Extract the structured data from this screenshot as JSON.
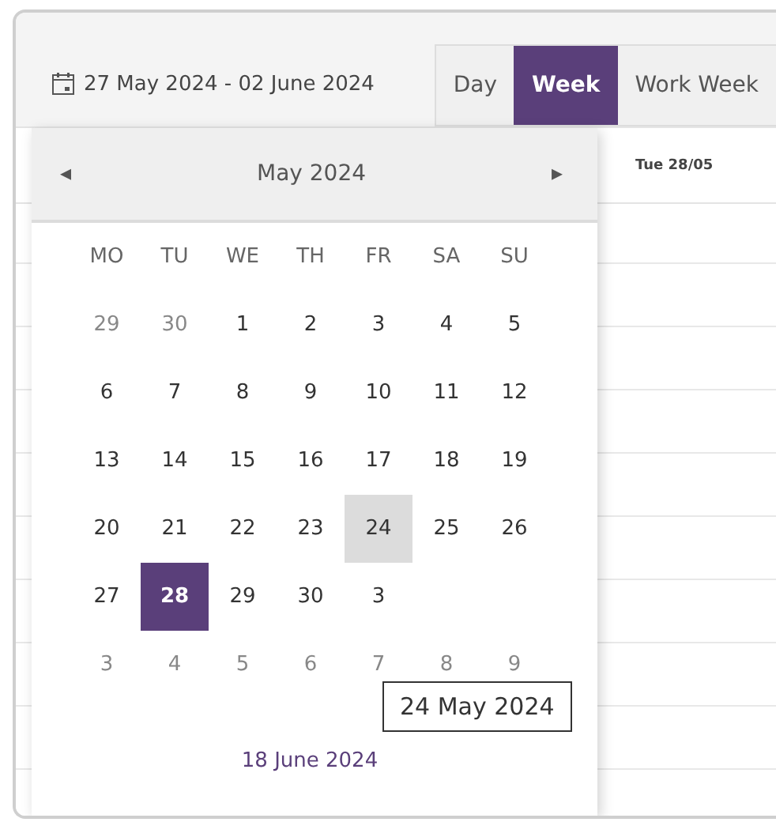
{
  "date_range": {
    "label": "27 May 2024 - 02 June 2024"
  },
  "view_tabs": [
    {
      "label": "Day",
      "selected": false
    },
    {
      "label": "Week",
      "selected": true
    },
    {
      "label": "Work Week",
      "selected": false
    }
  ],
  "week_header": {
    "label": "Tue 28/05"
  },
  "date_picker": {
    "prev": "◂",
    "title": "May 2024",
    "next": "▸",
    "weekdays": [
      "MO",
      "TU",
      "WE",
      "TH",
      "FR",
      "SA",
      "SU"
    ],
    "weeks": [
      [
        {
          "label": "29",
          "other_month": true,
          "selected": false,
          "hovered": false
        },
        {
          "label": "30",
          "other_month": true,
          "selected": false,
          "hovered": false
        },
        {
          "label": "1",
          "other_month": false,
          "selected": false,
          "hovered": false
        },
        {
          "label": "2",
          "other_month": false,
          "selected": false,
          "hovered": false
        },
        {
          "label": "3",
          "other_month": false,
          "selected": false,
          "hovered": false
        },
        {
          "label": "4",
          "other_month": false,
          "selected": false,
          "hovered": false
        },
        {
          "label": "5",
          "other_month": false,
          "selected": false,
          "hovered": false
        }
      ],
      [
        {
          "label": "6",
          "other_month": false,
          "selected": false,
          "hovered": false
        },
        {
          "label": "7",
          "other_month": false,
          "selected": false,
          "hovered": false
        },
        {
          "label": "8",
          "other_month": false,
          "selected": false,
          "hovered": false
        },
        {
          "label": "9",
          "other_month": false,
          "selected": false,
          "hovered": false
        },
        {
          "label": "10",
          "other_month": false,
          "selected": false,
          "hovered": false
        },
        {
          "label": "11",
          "other_month": false,
          "selected": false,
          "hovered": false
        },
        {
          "label": "12",
          "other_month": false,
          "selected": false,
          "hovered": false
        }
      ],
      [
        {
          "label": "13",
          "other_month": false,
          "selected": false,
          "hovered": false
        },
        {
          "label": "14",
          "other_month": false,
          "selected": false,
          "hovered": false
        },
        {
          "label": "15",
          "other_month": false,
          "selected": false,
          "hovered": false
        },
        {
          "label": "16",
          "other_month": false,
          "selected": false,
          "hovered": false
        },
        {
          "label": "17",
          "other_month": false,
          "selected": false,
          "hovered": false
        },
        {
          "label": "18",
          "other_month": false,
          "selected": false,
          "hovered": false
        },
        {
          "label": "19",
          "other_month": false,
          "selected": false,
          "hovered": false
        }
      ],
      [
        {
          "label": "20",
          "other_month": false,
          "selected": false,
          "hovered": false
        },
        {
          "label": "21",
          "other_month": false,
          "selected": false,
          "hovered": false
        },
        {
          "label": "22",
          "other_month": false,
          "selected": false,
          "hovered": false
        },
        {
          "label": "23",
          "other_month": false,
          "selected": false,
          "hovered": false
        },
        {
          "label": "24",
          "other_month": false,
          "selected": false,
          "hovered": true
        },
        {
          "label": "25",
          "other_month": false,
          "selected": false,
          "hovered": false
        },
        {
          "label": "26",
          "other_month": false,
          "selected": false,
          "hovered": false
        }
      ],
      [
        {
          "label": "27",
          "other_month": false,
          "selected": false,
          "hovered": false
        },
        {
          "label": "28",
          "other_month": false,
          "selected": true,
          "hovered": false
        },
        {
          "label": "29",
          "other_month": false,
          "selected": false,
          "hovered": false
        },
        {
          "label": "30",
          "other_month": false,
          "selected": false,
          "hovered": false
        },
        {
          "label": "3",
          "other_month": false,
          "selected": false,
          "hovered": false
        }
      ],
      [
        {
          "label": "3",
          "other_month": true,
          "selected": false,
          "hovered": false
        },
        {
          "label": "4",
          "other_month": true,
          "selected": false,
          "hovered": false
        },
        {
          "label": "5",
          "other_month": true,
          "selected": false,
          "hovered": false
        },
        {
          "label": "6",
          "other_month": true,
          "selected": false,
          "hovered": false
        },
        {
          "label": "7",
          "other_month": true,
          "selected": false,
          "hovered": false
        },
        {
          "label": "8",
          "other_month": true,
          "selected": false,
          "hovered": false
        },
        {
          "label": "9",
          "other_month": true,
          "selected": false,
          "hovered": false
        }
      ]
    ],
    "today_link": "18 June 2024",
    "tooltip": "24 May 2024"
  }
}
